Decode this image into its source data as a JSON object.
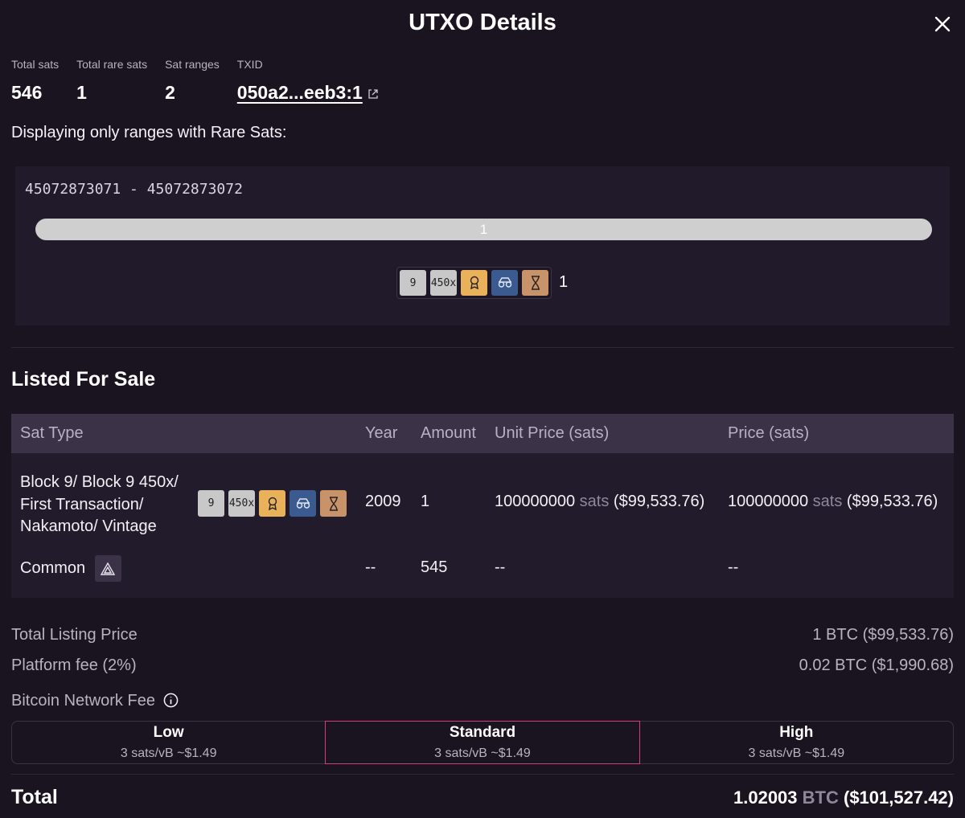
{
  "modal": {
    "title": "UTXO Details",
    "close_icon": "close-icon"
  },
  "stats": [
    {
      "label": "Total sats",
      "value": "546"
    },
    {
      "label": "Total rare sats",
      "value": "1"
    },
    {
      "label": "Sat ranges",
      "value": "2"
    },
    {
      "label": "TXID",
      "value": "050a2...eeb3:1"
    }
  ],
  "displaying_text": "Displaying only ranges with Rare Sats:",
  "range": {
    "label": "45072873071 - 45072873072",
    "bar_text": "1",
    "bar_fill_fraction": 1.0,
    "badges": [
      "9",
      "450x",
      "award-icon",
      "glasses-icon",
      "hourglass-icon"
    ],
    "count": "1"
  },
  "listed": {
    "title": "Listed For Sale",
    "headers": {
      "sat_type": "Sat Type",
      "year": "Year",
      "amount": "Amount",
      "unit_price": "Unit Price (sats)",
      "price": "Price (sats)"
    },
    "rows": [
      {
        "sat_type_lines": [
          "Block 9/ Block 9 450x/",
          "First Transaction/",
          "Nakamoto/ Vintage"
        ],
        "year": "2009",
        "amount": "1",
        "unit_price_num": "100000000",
        "unit_price_unit": "sats",
        "unit_price_usd": "($99,533.76)",
        "price_num": "100000000",
        "price_unit": "sats",
        "price_usd": "($99,533.76)"
      },
      {
        "sat_type": "Common",
        "year": "--",
        "amount": "545",
        "unit_price": "--",
        "price": "--"
      }
    ]
  },
  "summary": {
    "total_listing_label": "Total Listing Price",
    "total_listing_value": "1 BTC ($99,533.76)",
    "platform_fee_label": "Platform fee (2%)",
    "platform_fee_value": "0.02 BTC ($1,990.68)"
  },
  "network_fee": {
    "title": "Bitcoin Network Fee",
    "options": [
      {
        "name": "Low",
        "detail": "3 sats/vB ~$1.49"
      },
      {
        "name": "Standard",
        "detail": "3 sats/vB ~$1.49"
      },
      {
        "name": "High",
        "detail": "3 sats/vB ~$1.49"
      }
    ],
    "selected": "Standard",
    "selected_color": "#d23f7a"
  },
  "total": {
    "label": "Total",
    "amount": "1.02003",
    "unit": "BTC",
    "usd": "($101,527.42)"
  },
  "colors": {
    "background": "#1a1320",
    "panel": "#211a2b",
    "table_header": "#3b3248",
    "badge_gray": "#c8c8c8",
    "badge_gold": "#e9b15a",
    "badge_blue": "#3a5a90",
    "badge_tan": "#c9936a"
  }
}
